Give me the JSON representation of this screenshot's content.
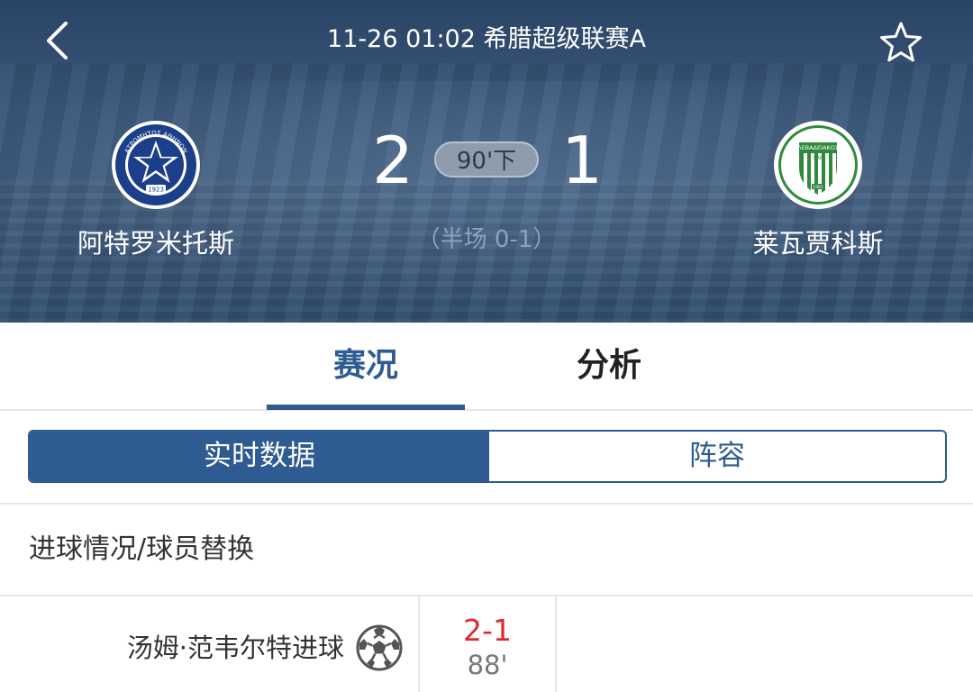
{
  "header": {
    "title": "11-26 01:02 希腊超级联赛A",
    "back_icon": "chevron-left-icon",
    "favorite_icon": "star-outline-icon"
  },
  "match": {
    "home": {
      "name": "阿特罗米托斯",
      "score": "2",
      "logo_color": "#1b3f8a",
      "logo_text": "ΑΤΡΟΜΗΤΟΣ ΑΘΗΝΩΝ",
      "logo_year": "1923"
    },
    "away": {
      "name": "莱瓦贾科斯",
      "score": "1",
      "logo_color": "#2e8a3c",
      "logo_text": "ΛΕΒΑΔΕΙΑΚΟΣ",
      "logo_sub": "ΠΑΕ",
      "logo_year": "1961"
    },
    "status": "90'下",
    "halftime": "（半场 0-1）"
  },
  "tabs": [
    {
      "label": "赛况",
      "active": true
    },
    {
      "label": "分析",
      "active": false
    }
  ],
  "segments": [
    {
      "label": "实时数据",
      "active": true
    },
    {
      "label": "阵容",
      "active": false
    }
  ],
  "section": {
    "title": "进球情况/球员替换"
  },
  "events": [
    {
      "text": "汤姆·范韦尔特进球",
      "score": "2-1",
      "minute": "88'",
      "icon": "soccer-ball-icon"
    }
  ],
  "colors": {
    "accent": "#2d5b92",
    "goal_score": "#e0292e",
    "header_bg": "#3a5678"
  }
}
